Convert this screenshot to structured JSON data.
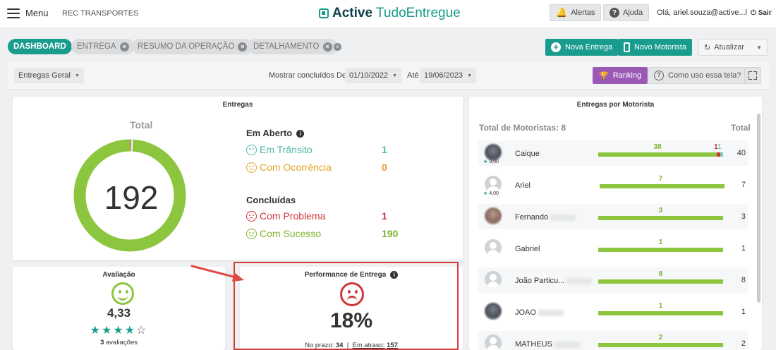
{
  "header": {
    "menu_label": "Menu",
    "company": "REC TRANSPORTES",
    "logo_active": "Active",
    "logo_tudo": "TudoEntregue",
    "alerts_label": "Alertas",
    "help_label": "Ajuda",
    "user_label": "Olá, ariel.souza@active...l",
    "logout_label": "Sair"
  },
  "tabs": [
    {
      "label": "DASHBOARD",
      "active": true
    },
    {
      "label": "ENTREGA",
      "active": false
    },
    {
      "label": "RESUMO DA OPERAÇÃO",
      "active": false
    },
    {
      "label": "DETALHAMENTO",
      "active": false
    }
  ],
  "actions": {
    "new_delivery": "Nova Entrega",
    "new_driver": "Novo Motorista",
    "refresh": "Atualizar"
  },
  "filters": {
    "type_value": "Entregas Geral",
    "show_completed_label": "Mostrar concluídos De",
    "date_from": "01/10/2022",
    "until_label": "Até",
    "date_to": "19/06/2023",
    "ranking_label": "Ranking",
    "help_screen_label": "Como uso essa tela?"
  },
  "deliveries": {
    "title": "Entregas",
    "total_label": "Total",
    "total": "192",
    "open_heading": "Em Aberto",
    "in_transit_label": "Em Trânsito",
    "in_transit": "1",
    "occurrence_label": "Com Ocorrência",
    "occurrence": "0",
    "done_heading": "Concluídas",
    "problem_label": "Com Problema",
    "problem": "1",
    "success_label": "Com Sucesso",
    "success": "190"
  },
  "evaluation": {
    "title": "Avaliação",
    "score": "4,33",
    "stars_filled": 4,
    "stars_total": 5,
    "count": "3",
    "count_label": "avaliações"
  },
  "performance": {
    "title": "Performance de Entrega",
    "percent": "18%",
    "on_time_label": "No prazo:",
    "on_time": "34",
    "late_label": "Em atraso:",
    "late": "157"
  },
  "drivers": {
    "title": "Entregas por Motorista",
    "count_label": "Total de Motoristas: 8",
    "total_header": "Total",
    "max_total": 40,
    "rows": [
      {
        "name": "Caique",
        "rating": "3,00",
        "success": 38,
        "problem": 1,
        "open": 1,
        "total": "40",
        "avatar": "photo"
      },
      {
        "name": "Ariel",
        "rating": "4,00",
        "success": 7,
        "total": "7",
        "avatar": "default"
      },
      {
        "name": "Fernando",
        "success": 3,
        "total": "3",
        "avatar": "photo2"
      },
      {
        "name": "Gabriel",
        "success": 1,
        "total": "1",
        "avatar": "default"
      },
      {
        "name": "João Particu...",
        "success": 8,
        "total": "8",
        "avatar": "default"
      },
      {
        "name": "JOAO",
        "success": 1,
        "total": "1",
        "avatar": "photo"
      },
      {
        "name": "MATHEUS",
        "success": 2,
        "total": "2",
        "avatar": "default"
      }
    ]
  },
  "colors": {
    "brand": "#199c8d",
    "success": "#8cc63f",
    "warning": "#e0a528",
    "danger": "#d0363a",
    "purple": "#9b59b6"
  }
}
